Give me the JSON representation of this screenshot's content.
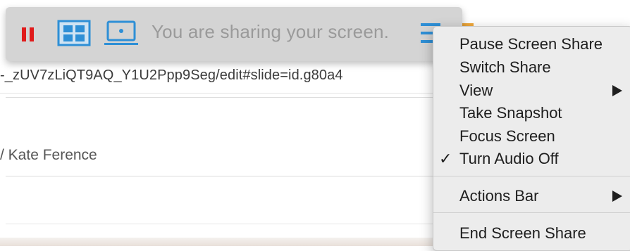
{
  "page": {
    "url_fragment": "-_zUV7zLiQT9AQ_Y1U2Ppp9Seg/edit#slide=id.g80a4",
    "owner_text": "/ Kate Ference"
  },
  "share_bar": {
    "status_text": "You are sharing your screen.",
    "pause_icon": "pause-icon",
    "layout_icon": "grid-layout-icon",
    "screen_icon": "screen-icon",
    "menu_icon": "hamburger-menu-icon"
  },
  "context_menu": {
    "items": [
      {
        "label": "Pause Screen Share",
        "checked": false,
        "submenu": false
      },
      {
        "label": "Switch Share",
        "checked": false,
        "submenu": false
      },
      {
        "label": "View",
        "checked": false,
        "submenu": true
      },
      {
        "label": "Take Snapshot",
        "checked": false,
        "submenu": false
      },
      {
        "label": "Focus Screen",
        "checked": false,
        "submenu": false
      },
      {
        "label": "Turn Audio Off",
        "checked": true,
        "submenu": false
      },
      {
        "label": "Actions Bar",
        "checked": false,
        "submenu": true
      },
      {
        "label": "End Screen Share",
        "checked": false,
        "submenu": false
      }
    ],
    "check_glyph": "✓"
  },
  "colors": {
    "pause_red": "#e01b1b",
    "accent_blue": "#2e8fd6",
    "toolbar_bg": "#d4d4d4",
    "menu_bg": "#ececec"
  }
}
